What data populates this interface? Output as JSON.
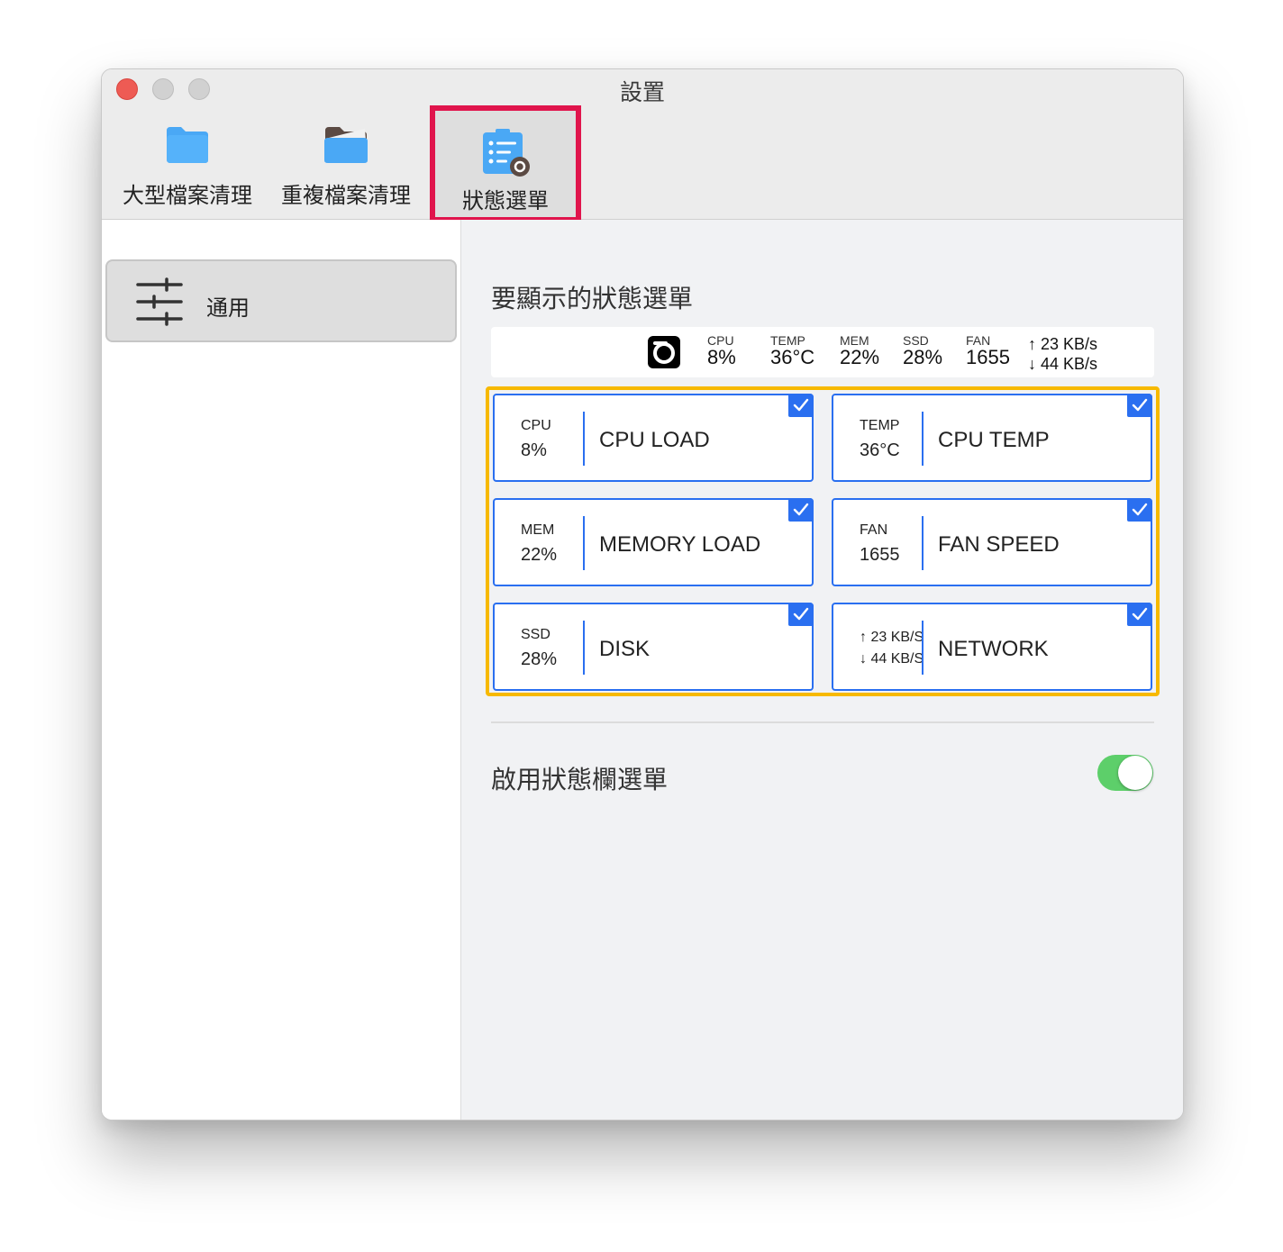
{
  "window": {
    "title": "設置"
  },
  "toolbar": {
    "items": [
      {
        "label": "大型檔案清理",
        "icon": "folder-icon"
      },
      {
        "label": "重複檔案清理",
        "icon": "open-folder-icon"
      },
      {
        "label": "狀態選單",
        "icon": "checklist-gear-icon",
        "selected": true
      }
    ]
  },
  "sidebar": {
    "items": [
      {
        "label": "通用",
        "icon": "sliders-icon",
        "selected": true
      }
    ]
  },
  "content": {
    "section_title": "要顯示的狀態選單",
    "preview": {
      "items": [
        {
          "key": "CPU",
          "value": "8%"
        },
        {
          "key": "TEMP",
          "value": "36°C"
        },
        {
          "key": "MEM",
          "value": "22%"
        },
        {
          "key": "SSD",
          "value": "28%"
        },
        {
          "key": "FAN",
          "value": "1655"
        }
      ],
      "net_up": "↑ 23 KB/s",
      "net_down": "↓ 44 KB/s"
    },
    "cards": [
      {
        "key": "CPU",
        "value": "8%",
        "name": "CPU LOAD",
        "checked": true
      },
      {
        "key": "TEMP",
        "value": "36°C",
        "name": "CPU TEMP",
        "checked": true
      },
      {
        "key": "MEM",
        "value": "22%",
        "name": "MEMORY LOAD",
        "checked": true
      },
      {
        "key": "FAN",
        "value": "1655",
        "name": "FAN SPEED",
        "checked": true
      },
      {
        "key": "SSD",
        "value": "28%",
        "name": "DISK",
        "checked": true
      },
      {
        "net_up": "↑ 23 KB/S",
        "net_down": "↓ 44 KB/S",
        "name": "NETWORK",
        "checked": true
      }
    ],
    "enable_label": "啟用狀態欄選單",
    "enable_toggle": true
  },
  "colors": {
    "accent": "#2a6ff0",
    "highlight_red": "#e0144c",
    "highlight_yellow": "#f7b900",
    "toggle_on": "#5dcf6a",
    "folder": "#4aa8f5"
  }
}
